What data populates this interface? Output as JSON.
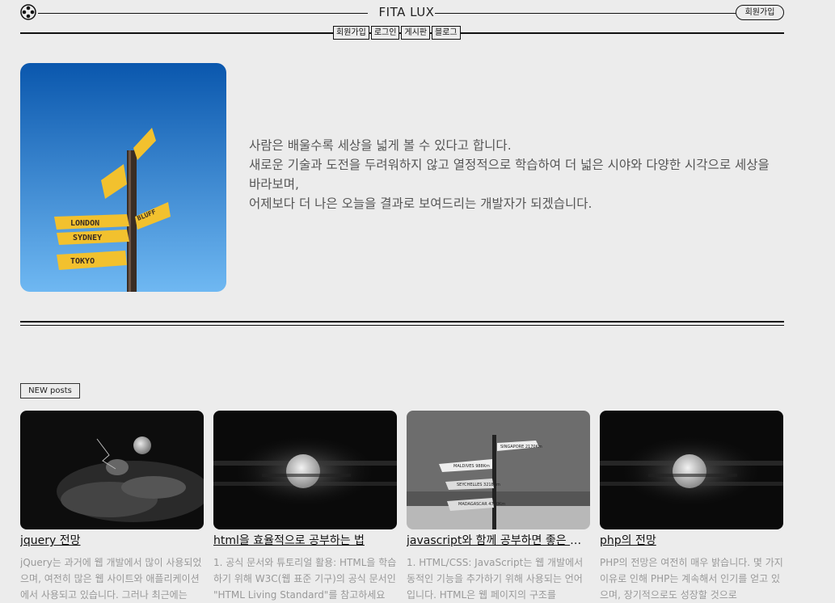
{
  "header": {
    "brand": "FITA LUX",
    "signup_button": "회원가입",
    "nav": [
      "회원가입",
      "로그인",
      "게시판",
      "블로그"
    ]
  },
  "hero": {
    "signs": [
      "LONDON",
      "SYDNEY",
      "TOKYO",
      "BLUFF"
    ],
    "lines": [
      "사람은 배울수록 세상을 넓게 볼 수 있다고 합니다.",
      "새로운 기술과 도전을 두려워하지 않고 열정적으로 학습하여 더 넓은 시야와 다양한 시각으로 세상을 바라보며,",
      "어제보다 더 나은 오늘을 결과로 보여드리는 개발자가 되겠습니다."
    ]
  },
  "posts_label": "NEW posts",
  "posts": [
    {
      "title": "jquery 전망",
      "text": "jQuery는 과거에 웹 개발에서 많이 사용되었으며, 여전히 많은 웹 사이트와 애플리케이션에서 사용되고 있습니다. 그러나 최근에는"
    },
    {
      "title": "html을 효율적으로 공부하는 법",
      "text": "1. 공식 문서와 튜토리얼 활용: HTML을 학습하기 위해 W3C(웹 표준 기구)의 공식 문서인 \"HTML Living Standard\"를 참고하세요"
    },
    {
      "title": "javascript와 함께 공부하면 좋은 언어",
      "text": "1. HTML/CSS: JavaScript는 웹 개발에서 동적인 기능을 추가하기 위해 사용되는 언어입니다. HTML은 웹 페이지의 구조를"
    },
    {
      "title": "php의 전망",
      "text": "PHP의 전망은 여전히 매우 밝습니다. 몇 가지 이유로 인해 PHP는 계속해서 인기를 얻고 있으며, 장기적으로도 성장할 것으로"
    }
  ],
  "signpost": {
    "signs": [
      "MALDIVES 988Km",
      "SEYCHELLES 3218Km",
      "MADAGASCAR 4780Km",
      "SINGAPORE 2170Km"
    ]
  },
  "colors": {
    "background": "#ececec",
    "line": "#111111",
    "muted_text": "#999999"
  }
}
